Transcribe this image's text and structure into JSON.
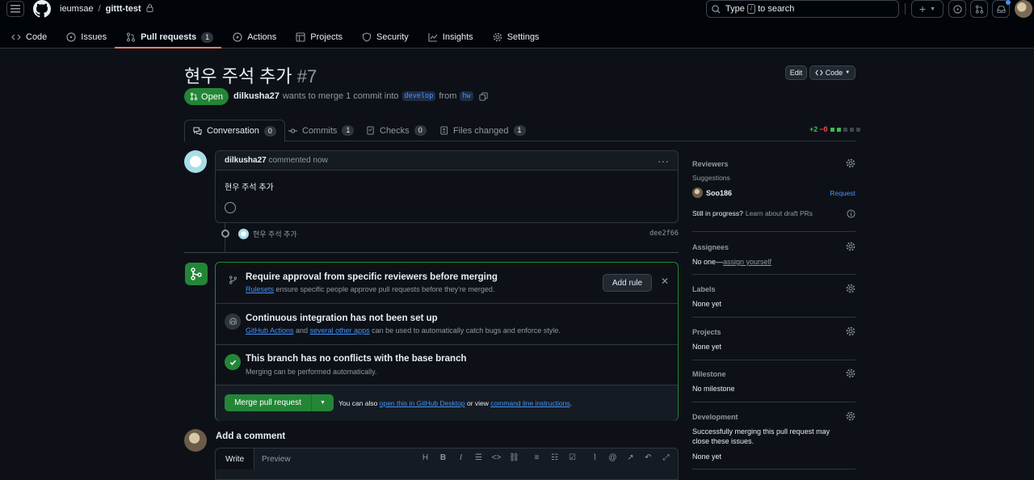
{
  "header": {
    "owner": "ieumsae",
    "separator": "/",
    "repo": "gittt-test",
    "search_placeholder_prefix": "Type",
    "search_key": "/",
    "search_placeholder_suffix": "to search"
  },
  "repo_nav": [
    {
      "label": "Code",
      "icon": "code-icon"
    },
    {
      "label": "Issues",
      "icon": "issue-icon"
    },
    {
      "label": "Pull requests",
      "icon": "pull-request-icon",
      "count": "1",
      "selected": true
    },
    {
      "label": "Actions",
      "icon": "play-icon"
    },
    {
      "label": "Projects",
      "icon": "table-icon"
    },
    {
      "label": "Security",
      "icon": "shield-icon"
    },
    {
      "label": "Insights",
      "icon": "graph-icon"
    },
    {
      "label": "Settings",
      "icon": "gear-icon"
    }
  ],
  "pr": {
    "title": "현우 주석 추가",
    "number": "#7",
    "edit_label": "Edit",
    "code_label": "Code",
    "state": "Open",
    "author": "dilkusha27",
    "meta_text": "wants to merge 1 commit into",
    "base_branch": "develop",
    "from_text": "from",
    "head_branch": "hw"
  },
  "tabs": [
    {
      "label": "Conversation",
      "count": "0",
      "icon": "comment-icon"
    },
    {
      "label": "Commits",
      "count": "1",
      "icon": "commit-icon"
    },
    {
      "label": "Checks",
      "count": "0",
      "icon": "checklist-icon"
    },
    {
      "label": "Files changed",
      "count": "1",
      "icon": "file-diff-icon"
    }
  ],
  "diffstat": {
    "additions": "+2",
    "deletions": "−0"
  },
  "comment": {
    "author": "dilkusha27",
    "when": "commented now",
    "body": "현우 주석 추가"
  },
  "commit": {
    "message": "현우 주석 추가",
    "sha": "dee2f66"
  },
  "merge_box": {
    "rules_title": "Require approval from specific reviewers before merging",
    "rules_link": "Rulesets",
    "rules_sub": "ensure specific people approve pull requests before they're merged.",
    "add_rule": "Add rule",
    "ci_title": "Continuous integration has not been set up",
    "ci_link1": "GitHub Actions",
    "ci_and": "and",
    "ci_link2": "several other apps",
    "ci_sub": "can be used to automatically catch bugs and enforce style.",
    "conflict_title": "This branch has no conflicts with the base branch",
    "conflict_sub": "Merging can be performed automatically.",
    "merge_button": "Merge pull request",
    "also_text": "You can also",
    "desktop_link": "open this in GitHub Desktop",
    "or_view": "or view",
    "cli_link": "command line instructions",
    "period": "."
  },
  "add_comment": {
    "title": "Add a comment",
    "write_tab": "Write",
    "preview_tab": "Preview"
  },
  "sidebar": {
    "reviewers": {
      "heading": "Reviewers",
      "suggestions": "Suggestions",
      "suggested_user": "Soo186",
      "request": "Request",
      "in_progress": "Still in progress?",
      "draft_link": "Learn about draft PRs"
    },
    "assignees": {
      "heading": "Assignees",
      "none": "No one—",
      "assign_link": "assign yourself"
    },
    "labels": {
      "heading": "Labels",
      "value": "None yet"
    },
    "projects": {
      "heading": "Projects",
      "value": "None yet"
    },
    "milestone": {
      "heading": "Milestone",
      "value": "No milestone"
    },
    "development": {
      "heading": "Development",
      "text": "Successfully merging this pull request may close these issues.",
      "value": "None yet"
    }
  },
  "colors": {
    "accent_green": "#238636",
    "link_blue": "#4493f8",
    "tab_underline": "#f78166"
  }
}
